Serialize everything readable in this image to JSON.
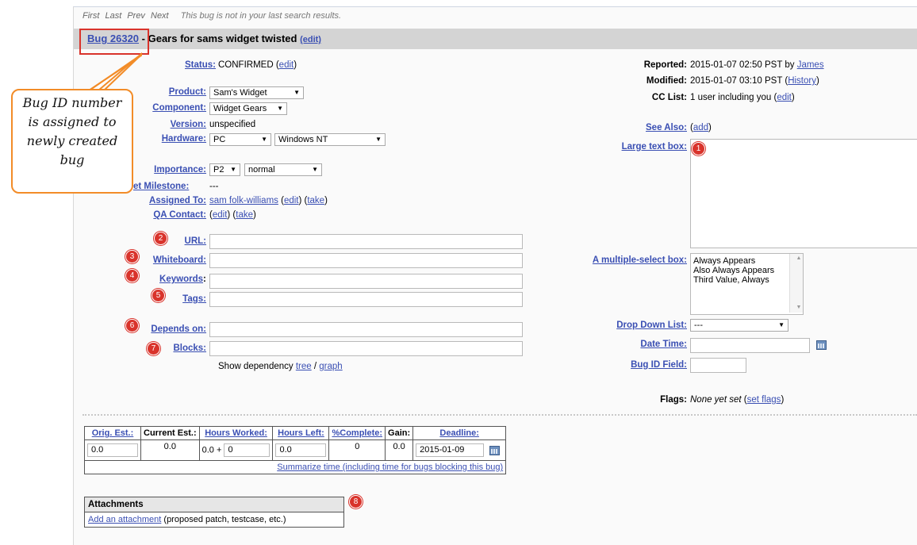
{
  "nav": {
    "first": "First",
    "last": "Last",
    "prev": "Prev",
    "next": "Next",
    "note": "This bug is not in your last search results."
  },
  "header": {
    "bug_link": "Bug 26320",
    "title": "- Gears for sams widget twisted",
    "edit": "(edit)"
  },
  "callout": {
    "lines": [
      "Bug ID number",
      "is assigned to",
      "newly created",
      "bug"
    ]
  },
  "left": {
    "status_label": "Status:",
    "status_value": "CONFIRMED",
    "status_edit": "edit",
    "product_label": "Product:",
    "product_value": "Sam's Widget",
    "component_label": "Component:",
    "component_value": "Widget Gears",
    "version_label": "Version:",
    "version_value": "unspecified",
    "hardware_label": "Hardware:",
    "hardware_value": "PC",
    "os_value": "Windows NT",
    "importance_label": "Importance:",
    "priority_value": "P2",
    "severity_value": "normal",
    "milestone_label": "et Milestone:",
    "milestone_value": "---",
    "assigned_label": "Assigned To:",
    "assigned_value": "sam folk-williams",
    "assigned_edit": "edit",
    "assigned_take": "take",
    "qa_label": "QA Contact:",
    "qa_edit": "edit",
    "qa_take": "take",
    "url_label": "URL:",
    "whiteboard_label": "Whiteboard:",
    "keywords_label": "Keywords",
    "tags_label": "Tags:",
    "depends_label": "Depends on:",
    "blocks_label": "Blocks:",
    "dep_text": "Show dependency",
    "dep_tree": "tree",
    "dep_sep": "/",
    "dep_graph": "graph"
  },
  "right": {
    "reported_label": "Reported:",
    "reported_value": "2015-01-07 02:50 PST by",
    "reported_by": "James",
    "modified_label": "Modified:",
    "modified_value": "2015-01-07 03:10 PST",
    "history": "History",
    "cc_label": "CC List:",
    "cc_value": "1 user including you",
    "cc_edit": "edit",
    "seealso_label": "See Also:",
    "seealso_add": "add",
    "large_label": "Large text box:",
    "multi_label": "A multiple-select box:",
    "multi_options": [
      "Always Appears",
      "Also Always Appears",
      "Third Value, Always"
    ],
    "dropdown_label": "Drop Down List:",
    "dropdown_value": "---",
    "datetime_label": "Date Time:",
    "bugid_label": "Bug ID Field:",
    "flags_label": "Flags:",
    "flags_value": "None yet set",
    "flags_set": "set flags"
  },
  "markers": [
    "1",
    "2",
    "3",
    "4",
    "5",
    "6",
    "7",
    "8"
  ],
  "time": {
    "headers": [
      "Orig. Est.:",
      "Current Est.:",
      "Hours Worked:",
      "Hours Left:",
      "%Complete:",
      "Gain:",
      "Deadline:"
    ],
    "orig": "0.0",
    "current": "0.0",
    "worked": "0.0 +",
    "worked_add": "0",
    "left": "0.0",
    "complete": "0",
    "gain": "0.0",
    "deadline": "2015-01-09",
    "summarize": "Summarize time (including time for bugs blocking this bug)"
  },
  "attachments": {
    "title": "Attachments",
    "add_link": "Add an attachment",
    "add_note": "(proposed patch, testcase, etc.)"
  },
  "colors": {
    "link": "#3a4fb3",
    "marker": "#d9332b",
    "callout_border": "#f28c28",
    "highlight_box": "#d9332b"
  }
}
